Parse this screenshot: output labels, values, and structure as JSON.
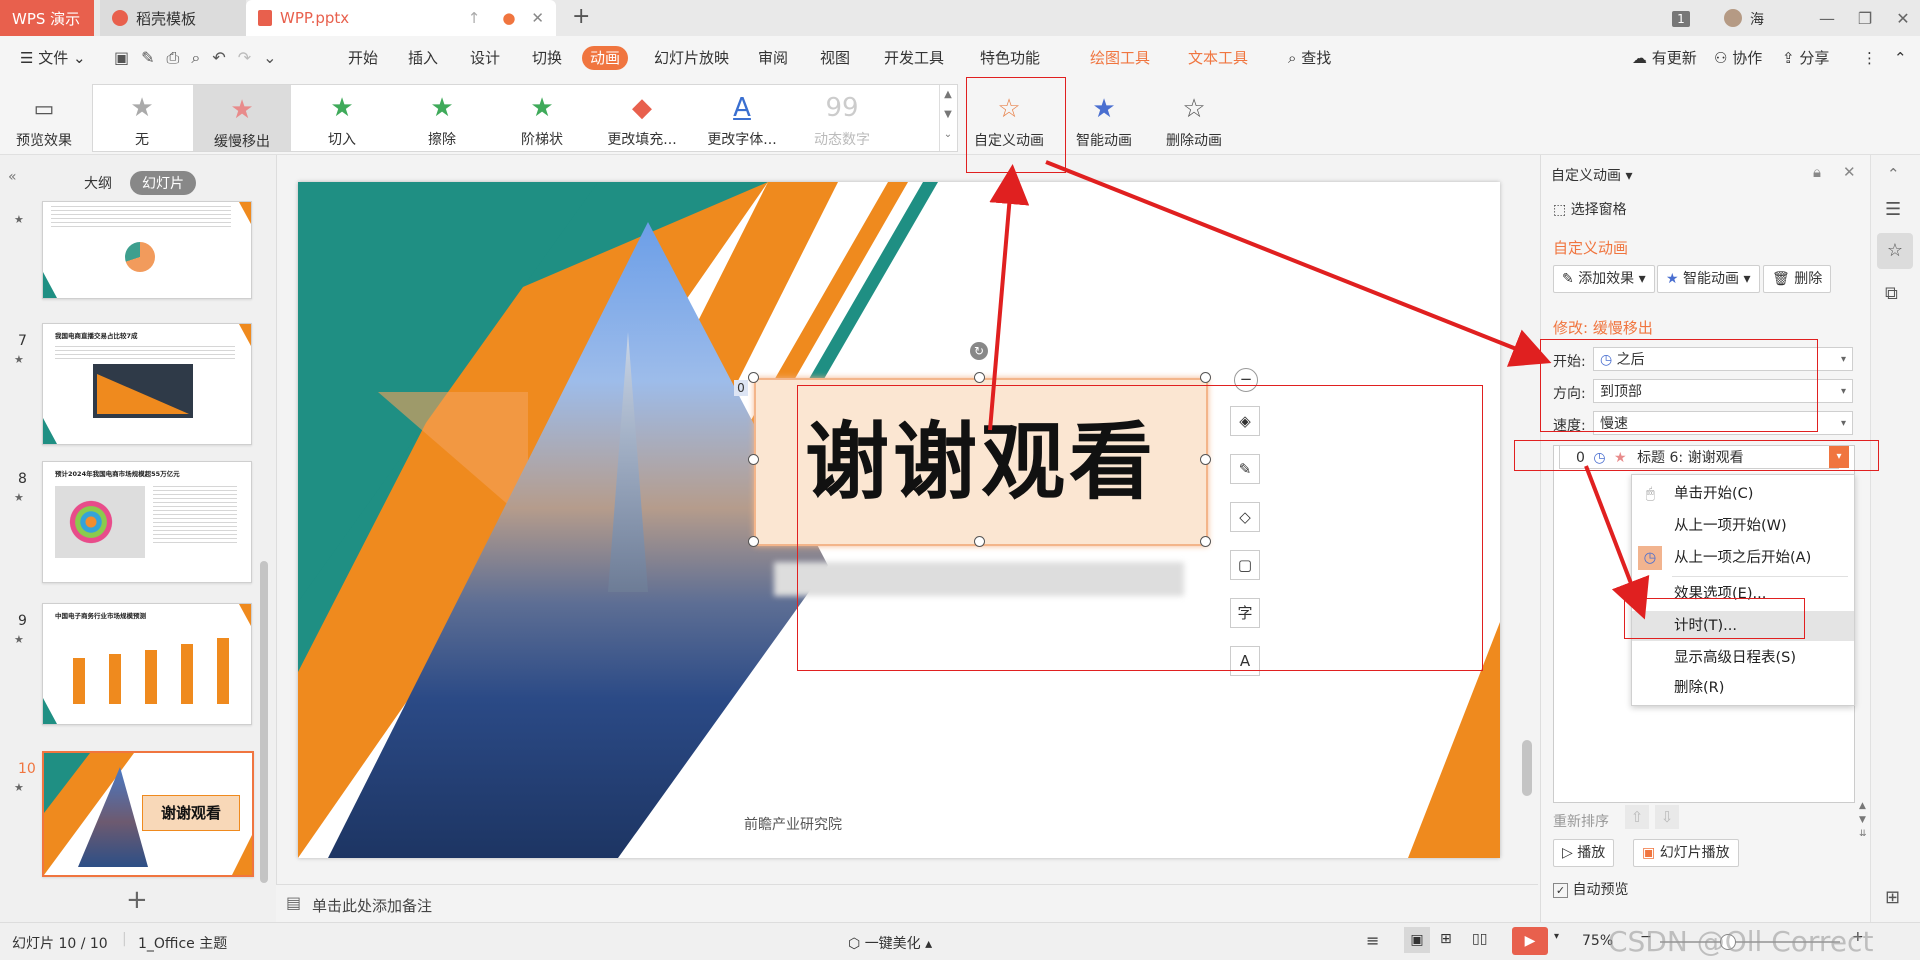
{
  "titlebar": {
    "app_tab": "WPS 演示",
    "template_tab": "稻壳模板",
    "doc_tab": "WPP.pptx",
    "user_count": "1",
    "user_name": "海"
  },
  "menubar": {
    "file": "文件",
    "items": [
      "开始",
      "插入",
      "设计",
      "切换",
      "动画",
      "幻灯片放映",
      "审阅",
      "视图",
      "开发工具",
      "特色功能"
    ],
    "tools": [
      "绘图工具",
      "文本工具"
    ],
    "search": "查找",
    "update": "有更新",
    "collab": "协作",
    "share": "分享"
  },
  "ribbon": {
    "preview": "预览效果",
    "effects": [
      "无",
      "缓慢移出",
      "切入",
      "擦除",
      "阶梯状",
      "更改填充...",
      "更改字体...",
      "动态数字"
    ],
    "custom": "自定义动画",
    "smart": "智能动画",
    "delete": "删除动画"
  },
  "leftpanel": {
    "tab_outline": "大纲",
    "tab_slides": "幻灯片",
    "thumbs": [
      {
        "num": "",
        "title": ""
      },
      {
        "num": "7",
        "title": "我国电商直播交易占比较7成"
      },
      {
        "num": "8",
        "title": "预计2024年我国电商市场规模超55万亿元"
      },
      {
        "num": "9",
        "title": "中国电子商务行业市场规模预测"
      },
      {
        "num": "10",
        "title": "谢谢观看"
      }
    ]
  },
  "slide": {
    "title": "谢谢观看",
    "footer": "前瞻产业研究院",
    "anim_index": "0",
    "note": "单击此处添加备注"
  },
  "rightpane": {
    "header": "自定义动画",
    "select_pane": "选择窗格",
    "section_title": "自定义动画",
    "add_effect": "添加效果",
    "smart_anim": "智能动画",
    "delete": "删除",
    "modify": "修改: 缓慢移出",
    "start_label": "开始:",
    "start_value": "之后",
    "dir_label": "方向:",
    "dir_value": "到顶部",
    "speed_label": "速度:",
    "speed_value": "慢速",
    "list_item_index": "0",
    "list_item_label": "标题 6: 谢谢观看",
    "reorder": "重新排序",
    "play": "播放",
    "slideshow": "幻灯片播放",
    "auto_preview": "自动预览"
  },
  "contextmenu": [
    "单击开始(C)",
    "从上一项开始(W)",
    "从上一项之后开始(A)",
    "效果选项(E)...",
    "计时(T)...",
    "显示高级日程表(S)",
    "删除(R)"
  ],
  "statusbar": {
    "slide_pos": "幻灯片 10 / 10",
    "theme": "1_Office 主题",
    "beautify": "一键美化",
    "zoom": "75%",
    "watermark": "CSDN @Oll Correct"
  },
  "colors": {
    "accent": "#f0753f",
    "orange": "#ef8a1e",
    "teal": "#1f8f83",
    "annotation": "#e02020"
  }
}
